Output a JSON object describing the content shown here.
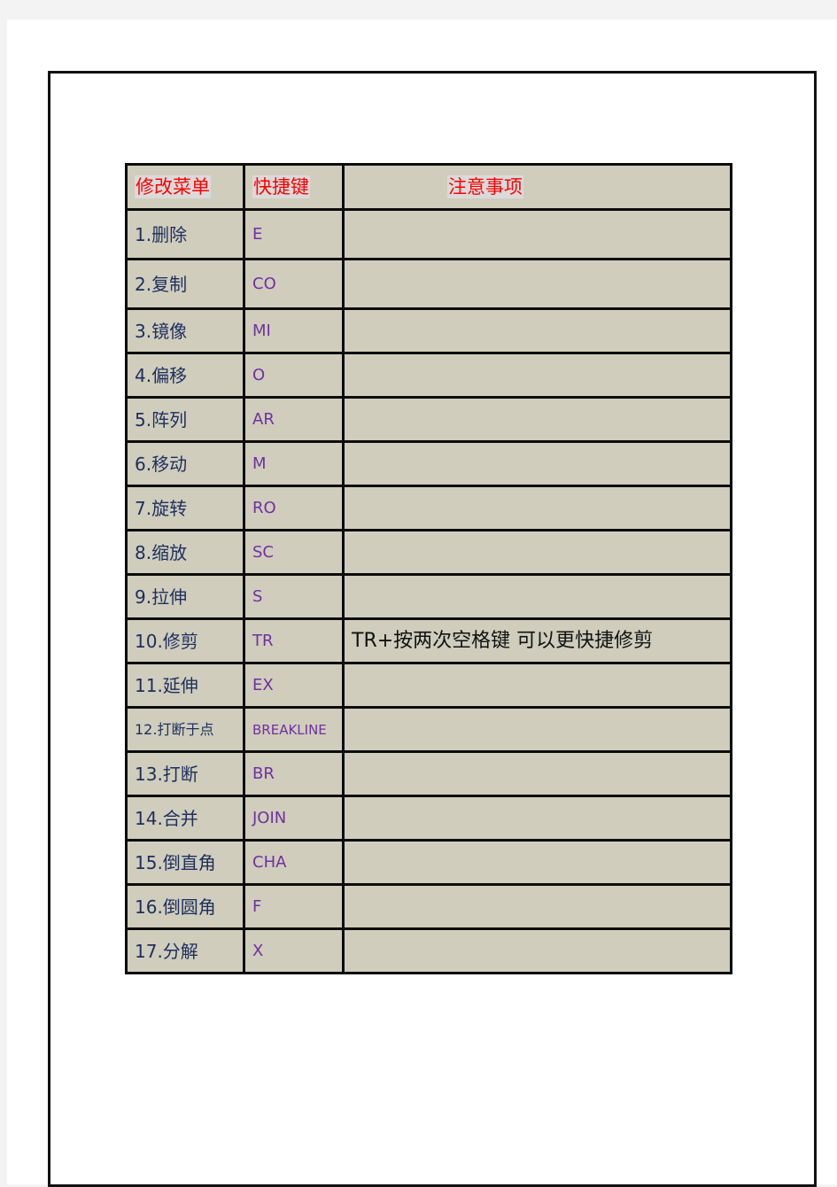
{
  "table": {
    "headers": {
      "menu": "修改菜单",
      "shortcut": "快捷键",
      "notes": "注意事项"
    },
    "rows": [
      {
        "item": "1.删除",
        "shortcut": "E",
        "note": ""
      },
      {
        "item": "2.复制",
        "shortcut": "CO",
        "note": ""
      },
      {
        "item": "3.镜像",
        "shortcut": "MI",
        "note": ""
      },
      {
        "item": "4.偏移",
        "shortcut": "O",
        "note": ""
      },
      {
        "item": "5.阵列",
        "shortcut": "AR",
        "note": ""
      },
      {
        "item": "6.移动",
        "shortcut": "M",
        "note": ""
      },
      {
        "item": "7.旋转",
        "shortcut": "RO",
        "note": ""
      },
      {
        "item": "8.缩放",
        "shortcut": "SC",
        "note": ""
      },
      {
        "item": "9.拉伸",
        "shortcut": "S",
        "note": ""
      },
      {
        "item": "10.修剪",
        "shortcut": "TR",
        "note": "TR+按两次空格键  可以更快捷修剪"
      },
      {
        "item": "11.延伸",
        "shortcut": "EX",
        "note": ""
      },
      {
        "item": "12.打断于点",
        "shortcut": "BREAKLINE",
        "note": ""
      },
      {
        "item": "13.打断",
        "shortcut": "BR",
        "note": ""
      },
      {
        "item": "14.合并",
        "shortcut": "JOIN",
        "note": ""
      },
      {
        "item": "15.倒直角",
        "shortcut": "CHA",
        "note": ""
      },
      {
        "item": "16.倒圆角",
        "shortcut": "F",
        "note": ""
      },
      {
        "item": "17.分解",
        "shortcut": "X",
        "note": ""
      }
    ]
  },
  "colors": {
    "header_text": "#ff0000",
    "item_text": "#1c2f5c",
    "shortcut_text": "#7030a0",
    "cell_background": "#d0cdbd"
  }
}
